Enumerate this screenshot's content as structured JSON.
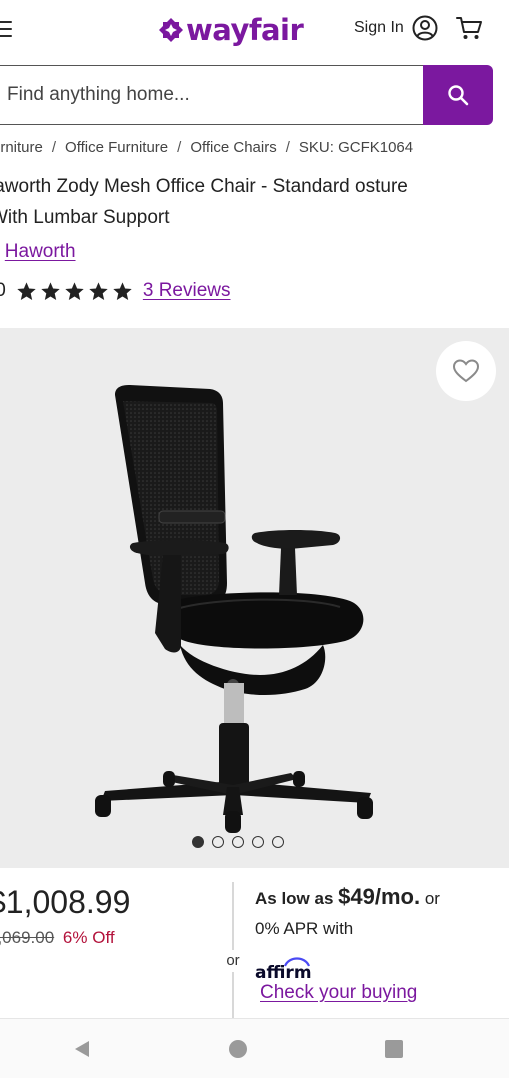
{
  "brand": {
    "name": "wayfair",
    "color": "#7b189f"
  },
  "header": {
    "signin_label": "Sign In",
    "icons": [
      "menu-icon",
      "user-icon",
      "cart-icon"
    ]
  },
  "search": {
    "placeholder": "Find anything home...",
    "icon": "search-icon"
  },
  "breadcrumb": {
    "items": [
      "urniture",
      "Office Furniture",
      "Office Chairs"
    ],
    "sku": "SKU: GCFK1064",
    "separator": "/"
  },
  "product": {
    "title": "laworth Zody Mesh Office Chair - Standard osture With Lumbar Support",
    "by_prefix": "y",
    "brand_link": "Haworth",
    "rating": ".0",
    "stars_filled": 5,
    "reviews_link": "3 Reviews"
  },
  "gallery": {
    "image_count": 5,
    "active_index": 0,
    "favorite_icon": "heart-icon"
  },
  "pricing": {
    "price": "$1,008.99",
    "was_price": "1,069.00",
    "discount": "6% Off",
    "or_label": "or",
    "finance_lead": "As low as",
    "finance_amount": "$49/mo.",
    "finance_tail": " or",
    "finance_apr": "0% APR with",
    "finance_provider": "affirm",
    "check_link": "Check your buying"
  },
  "colors": {
    "accent": "#7b189f",
    "sale": "#b3123b",
    "gallery_bg": "#ececec"
  },
  "system_nav": {
    "icons": [
      "back-icon",
      "home-icon",
      "recents-icon"
    ]
  }
}
